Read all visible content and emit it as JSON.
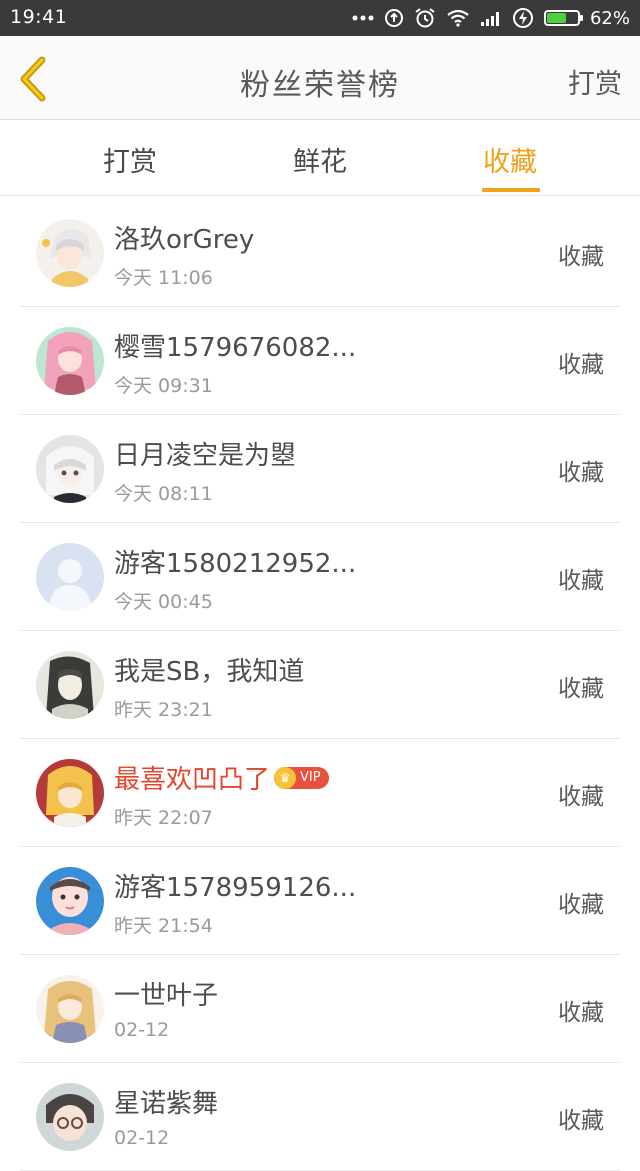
{
  "status_bar": {
    "time": "19:41",
    "battery_percent": "62%",
    "battery_level": 0.62
  },
  "header": {
    "title": "粉丝荣誉榜",
    "action_label": "打赏",
    "back_icon": "chevron-left-icon",
    "accent_color": "#f0a21b"
  },
  "tabs": [
    {
      "label": "打赏",
      "active": false
    },
    {
      "label": "鲜花",
      "active": false
    },
    {
      "label": "收藏",
      "active": true
    }
  ],
  "rows": [
    {
      "name": "洛玖orGrey",
      "time": "今天 11:06",
      "action": "收藏",
      "vip": false
    },
    {
      "name": "樱雪1579676082...",
      "time": "今天 09:31",
      "action": "收藏",
      "vip": false
    },
    {
      "name": "日月凌空是为曌",
      "time": "今天 08:11",
      "action": "收藏",
      "vip": false
    },
    {
      "name": "游客1580212952...",
      "time": "今天 00:45",
      "action": "收藏",
      "vip": false
    },
    {
      "name": "我是SB，我知道",
      "time": "昨天 23:21",
      "action": "收藏",
      "vip": false
    },
    {
      "name": "最喜欢凹凸了",
      "time": "昨天 22:07",
      "action": "收藏",
      "vip": true,
      "badge": "VIP"
    },
    {
      "name": "游客1578959126...",
      "time": "昨天 21:54",
      "action": "收藏",
      "vip": false
    },
    {
      "name": "一世叶子",
      "time": "02-12",
      "action": "收藏",
      "vip": false
    },
    {
      "name": "星诺紫舞",
      "time": "02-12",
      "action": "收藏",
      "vip": false
    }
  ]
}
